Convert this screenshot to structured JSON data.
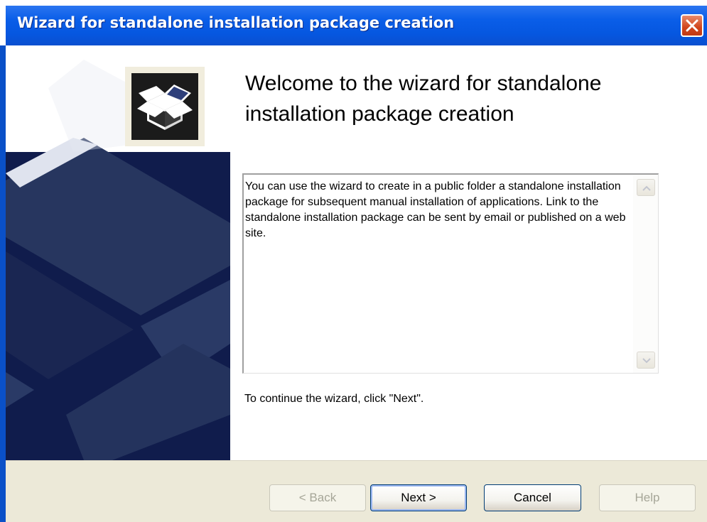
{
  "window": {
    "title": "Wizard for standalone installation package creation",
    "close_icon": "close-icon"
  },
  "side_panel": {
    "icon": "package-box-icon"
  },
  "main": {
    "heading": "Welcome to the wizard for standalone installation package creation",
    "description": "You can use the wizard to create in a public folder a standalone installation package for subsequent manual installation of applications. Link to the standalone installation package can be sent by email or published on a web site.",
    "continue_hint": "To continue the wizard, click \"Next\"."
  },
  "buttons": {
    "back": {
      "label": "< Back",
      "enabled": false
    },
    "next": {
      "label": "Next >",
      "enabled": true,
      "default": true
    },
    "cancel": {
      "label": "Cancel",
      "enabled": true
    },
    "help": {
      "label": "Help",
      "enabled": false
    }
  },
  "colors": {
    "titlebar": "#0a5ee8",
    "side_panel": "#0e1a47",
    "button_bar": "#ece9d8",
    "close_button": "#d1451c"
  }
}
